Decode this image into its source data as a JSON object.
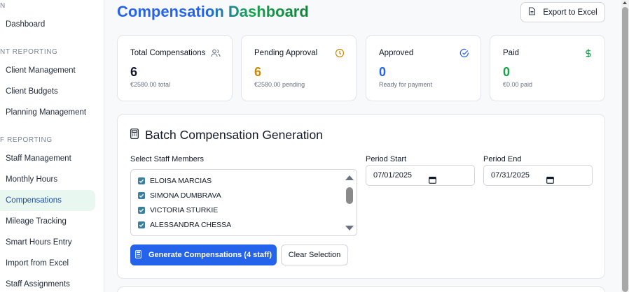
{
  "sidebar": {
    "sections": [
      {
        "label": "N"
      },
      {
        "label": "NT REPORTING"
      },
      {
        "label": "F REPORTING"
      }
    ],
    "items": [
      {
        "label": "Dashboard"
      },
      {
        "label": "Client Management"
      },
      {
        "label": "Client Budgets"
      },
      {
        "label": "Planning Management"
      },
      {
        "label": "Staff Management"
      },
      {
        "label": "Monthly Hours"
      },
      {
        "label": "Compensations"
      },
      {
        "label": "Mileage Tracking"
      },
      {
        "label": "Smart Hours Entry"
      },
      {
        "label": "Import from Excel"
      },
      {
        "label": "Staff Assignments"
      }
    ],
    "active_item": "Compensations"
  },
  "header": {
    "title": "Compensation Dashboard",
    "export_label": "Export to Excel"
  },
  "stats": [
    {
      "label": "Total Compensations",
      "value": "6",
      "sub": "€2580.00 total",
      "icon": "users-icon",
      "color": "#111827"
    },
    {
      "label": "Pending Approval",
      "value": "6",
      "sub": "€2580.00 pending",
      "icon": "clock-icon",
      "color": "#ca8a04"
    },
    {
      "label": "Approved",
      "value": "0",
      "sub": "Ready for payment",
      "icon": "check-circle-icon",
      "color": "#2563eb"
    },
    {
      "label": "Paid",
      "value": "0",
      "sub": "€0.00 paid",
      "icon": "dollar-icon",
      "color": "#16a34a"
    }
  ],
  "batch": {
    "title": "Batch Compensation Generation",
    "staff_label": "Select Staff Members",
    "staff": [
      {
        "name": "ELOISA MARCIAS",
        "checked": true
      },
      {
        "name": "SIMONA DUMBRAVA",
        "checked": true
      },
      {
        "name": "VICTORIA STURKIE",
        "checked": true
      },
      {
        "name": "ALESSANDRA CHESSA",
        "checked": true
      }
    ],
    "period_start_label": "Period Start",
    "period_start_value": "07/01/2025",
    "period_end_label": "Period End",
    "period_end_value": "07/31/2025",
    "generate_label": "Generate Compensations (4 staff)",
    "clear_label": "Clear Selection"
  },
  "colors": {
    "accent": "#2563eb",
    "active_bg": "#e8f7ef",
    "checkbox": "#3b7fa0"
  }
}
